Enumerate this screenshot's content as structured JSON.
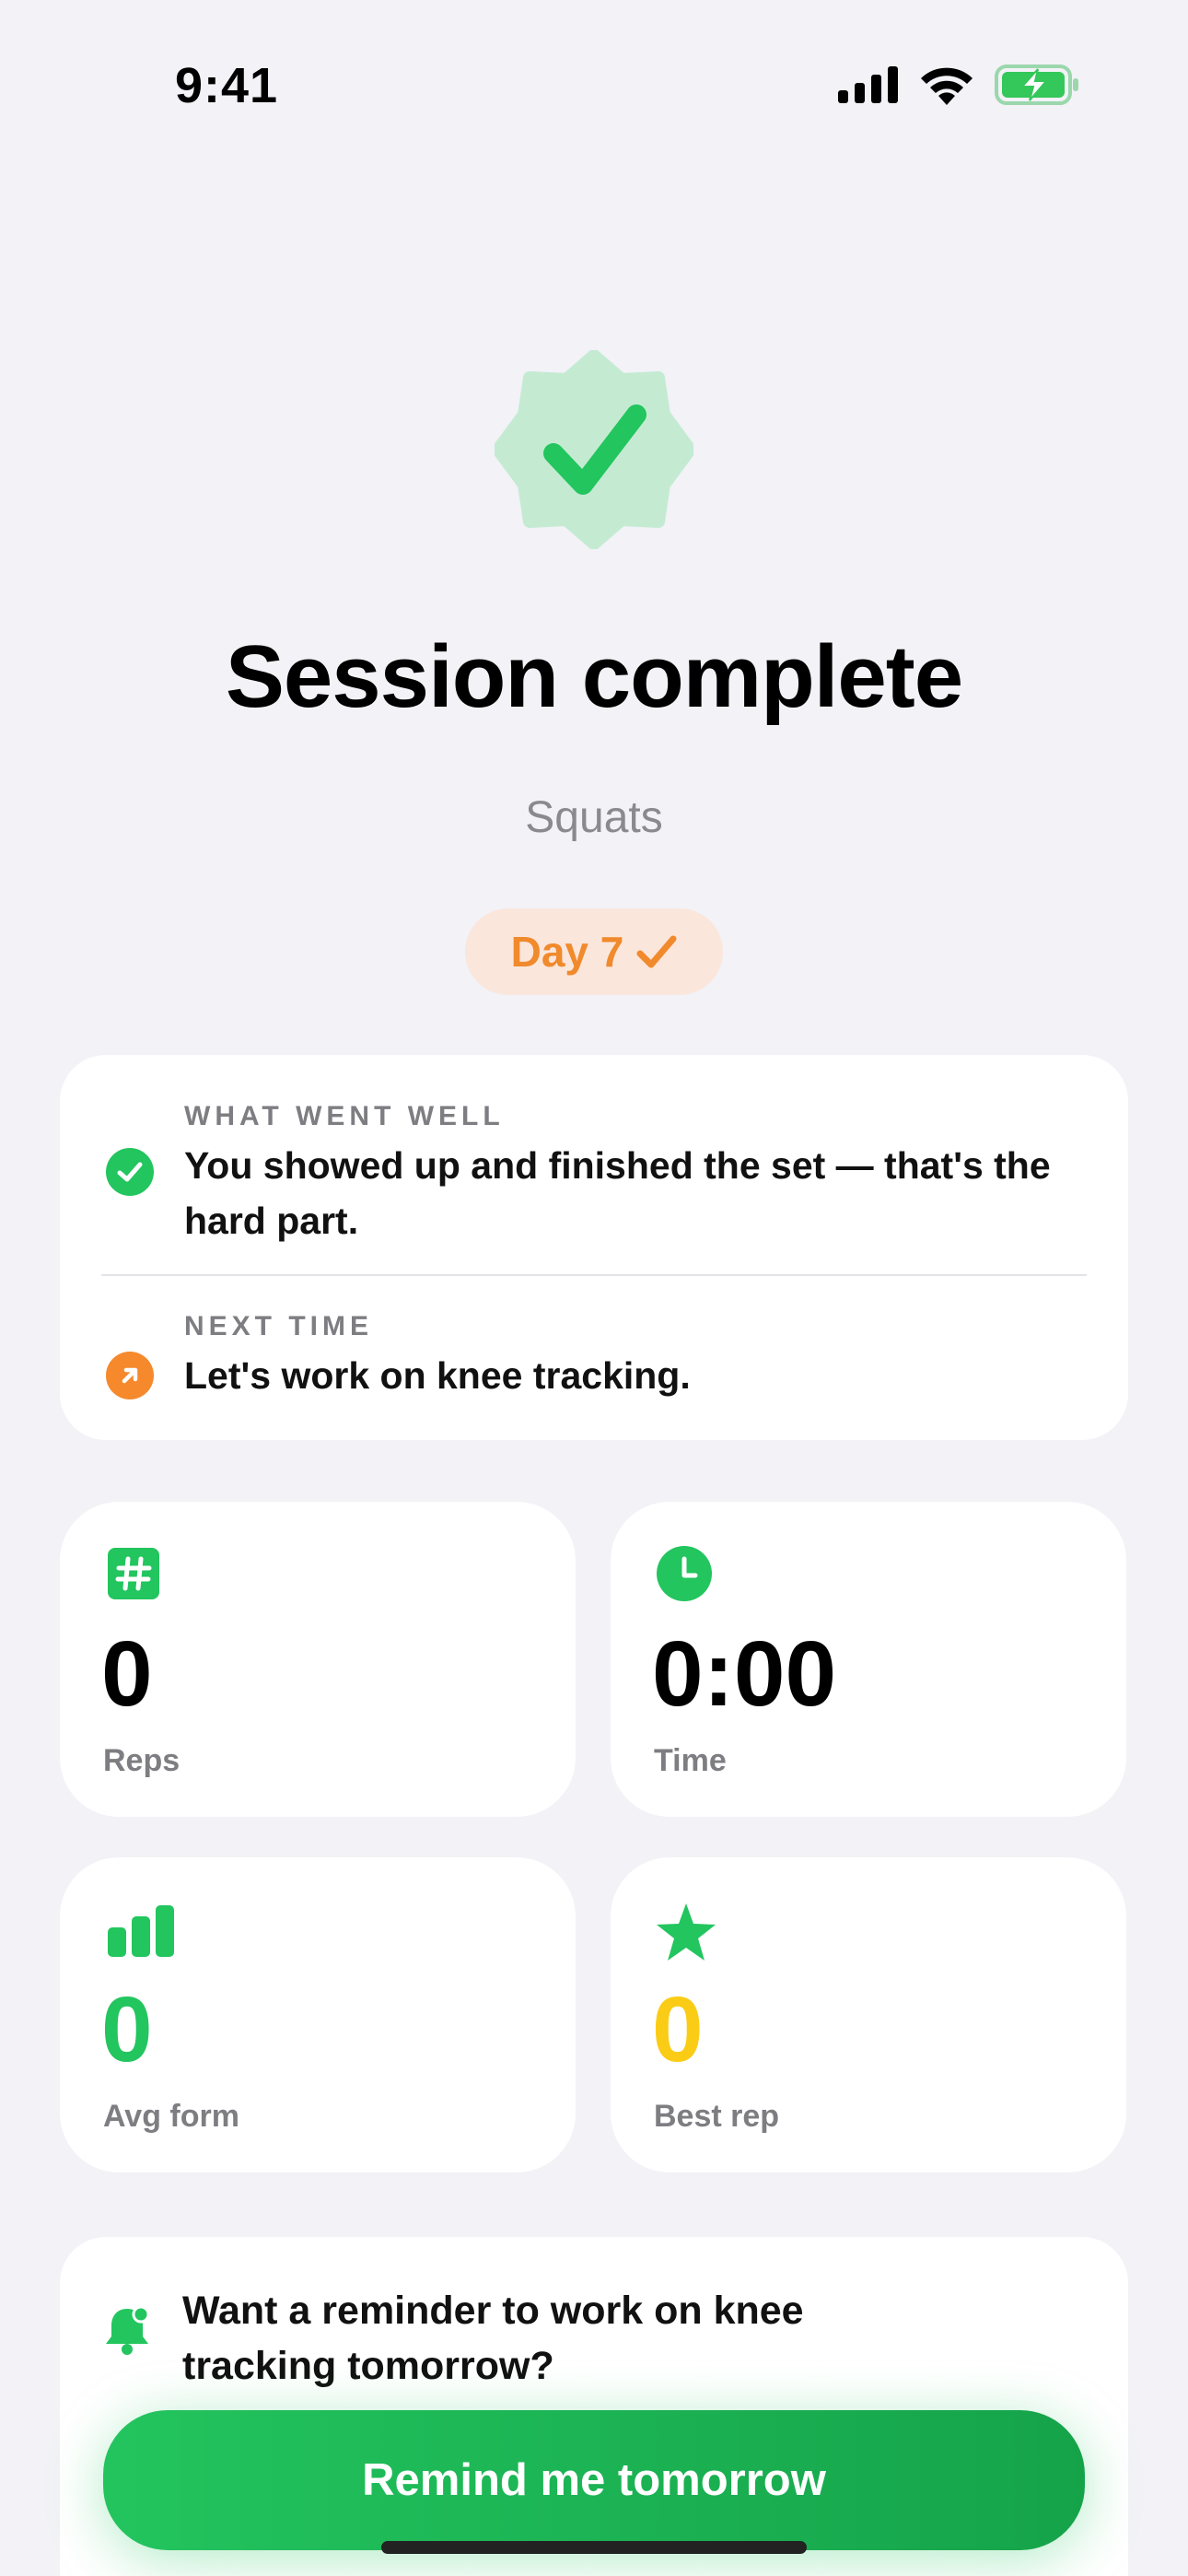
{
  "status_bar": {
    "time": "9:41"
  },
  "hero": {
    "title": "Session complete",
    "subtitle": "Squats",
    "day_badge": "Day 7"
  },
  "feedback": {
    "went_well": {
      "label": "WHAT WENT WELL",
      "text": "You showed up and finished the set — that's the hard part."
    },
    "next_time": {
      "label": "NEXT TIME",
      "text": "Let's work on knee tracking."
    }
  },
  "stats": [
    {
      "value": "0",
      "label": "Reps",
      "icon": "hash-icon",
      "color": "#000000"
    },
    {
      "value": "0:00",
      "label": "Time",
      "icon": "clock-icon",
      "color": "#000000"
    },
    {
      "value": "0",
      "label": "Avg form",
      "icon": "bar-chart-icon",
      "color": "#22c55e"
    },
    {
      "value": "0",
      "label": "Best rep",
      "icon": "star-icon",
      "color": "#facc15"
    }
  ],
  "reminder": {
    "prompt": "Want a reminder to work on knee tracking tomorrow?",
    "button_label": "Remind me tomorrow"
  },
  "colors": {
    "accent_green": "#22c55e",
    "accent_orange": "#f08a2c",
    "accent_yellow": "#facc15"
  }
}
